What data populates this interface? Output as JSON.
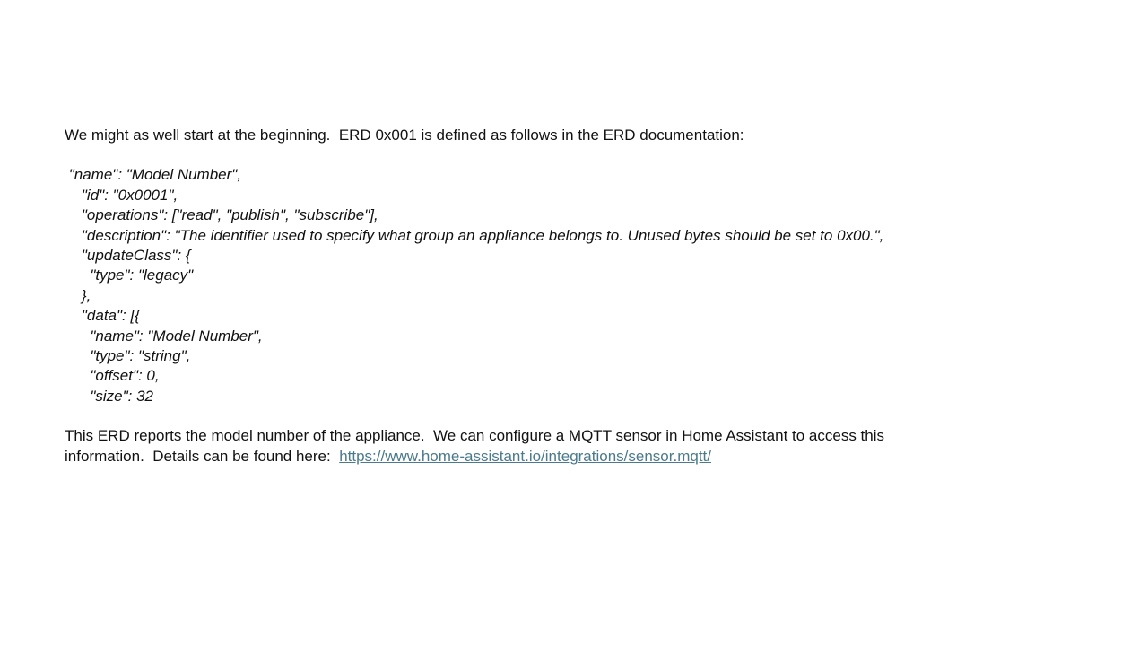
{
  "intro": "We might as well start at the beginning.  ERD 0x001 is defined as follows in the ERD documentation:",
  "code_lines": [
    " \"name\": \"Model Number\",",
    "    \"id\": \"0x0001\",",
    "    \"operations\": [\"read\", \"publish\", \"subscribe\"],",
    "    \"description\": \"The identifier used to specify what group an appliance belongs to. Unused bytes should be set to 0x00.\",",
    "    \"updateClass\": {",
    "      \"type\": \"legacy\"",
    "    },",
    "    \"data\": [{",
    "      \"name\": \"Model Number\",",
    "      \"type\": \"string\",",
    "      \"offset\": 0,",
    "      \"size\": 32"
  ],
  "outro": {
    "line1": "This ERD reports the model number of the appliance.  We can configure a MQTT sensor in Home Assistant to access this",
    "line2_prefix": "information.  Details can be found here:  ",
    "link_text": "https://www.home-assistant.io/integrations/sensor.mqtt/"
  },
  "colors": {
    "text": "#111111",
    "link": "#4a7a8c",
    "background": "#ffffff"
  }
}
